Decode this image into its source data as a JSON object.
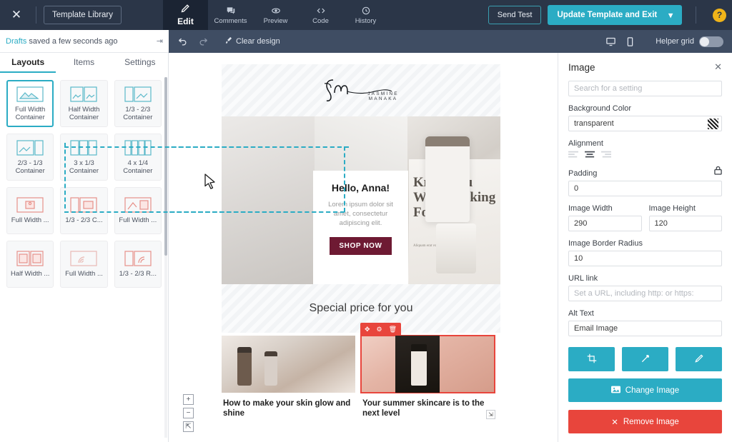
{
  "topbar": {
    "close_icon": "close-icon",
    "template_library_label": "Template Library",
    "nav": [
      {
        "label": "Edit",
        "icon": "pencil-icon",
        "active": true
      },
      {
        "label": "Comments",
        "icon": "comment-icon",
        "active": false
      },
      {
        "label": "Preview",
        "icon": "eye-icon",
        "active": false
      },
      {
        "label": "Code",
        "icon": "code-icon",
        "active": false
      },
      {
        "label": "History",
        "icon": "history-icon",
        "active": false
      }
    ],
    "send_test_label": "Send Test",
    "update_label": "Update Template and Exit",
    "update_chevron": "▾",
    "help_label": "?"
  },
  "secondbar": {
    "drafts_label": "Drafts",
    "saved_text": "saved a few seconds ago",
    "collapse_icon": "collapse-panel-icon",
    "undo_icon": "undo-icon",
    "redo_icon": "redo-icon",
    "clear_design_label": "Clear design",
    "desktop_icon": "desktop-view-icon",
    "mobile_icon": "mobile-view-icon",
    "helper_grid_label": "Helper grid",
    "helper_grid_on": false
  },
  "sidebar": {
    "tabs": [
      {
        "label": "Layouts",
        "active": true
      },
      {
        "label": "Items",
        "active": false
      },
      {
        "label": "Settings",
        "active": false
      }
    ],
    "layouts": [
      {
        "label": "Full Width Container",
        "icon": "full-width-container-icon",
        "selected": true,
        "color": "teal"
      },
      {
        "label": "Half Width Container",
        "icon": "half-width-container-icon",
        "selected": false,
        "color": "teal"
      },
      {
        "label": "1/3 - 2/3 Container",
        "icon": "third-two-thirds-container-icon",
        "selected": false,
        "color": "teal"
      },
      {
        "label": "2/3 - 1/3 Container",
        "icon": "two-thirds-third-container-icon",
        "selected": false,
        "color": "teal"
      },
      {
        "label": "3 x 1/3 Container",
        "icon": "three-thirds-container-icon",
        "selected": false,
        "color": "teal"
      },
      {
        "label": "4 x 1/4 Container",
        "icon": "four-quarters-container-icon",
        "selected": false,
        "color": "teal"
      },
      {
        "label": "Full Width ...",
        "icon": "full-width-image-icon",
        "selected": false,
        "color": "red"
      },
      {
        "label": "1/3 - 2/3 C...",
        "icon": "third-two-thirds-image-icon",
        "selected": false,
        "color": "red"
      },
      {
        "label": "Full Width ...",
        "icon": "full-width-text-image-icon",
        "selected": false,
        "color": "red"
      },
      {
        "label": "Half Width ...",
        "icon": "half-width-image-icon",
        "selected": false,
        "color": "red"
      },
      {
        "label": "Full Width ...",
        "icon": "full-width-banner-icon",
        "selected": false,
        "color": "red"
      },
      {
        "label": "1/3 - 2/3 R...",
        "icon": "third-two-thirds-right-icon",
        "selected": false,
        "color": "red"
      }
    ]
  },
  "canvas": {
    "logo": {
      "monogram": "Jm",
      "name": "JASMINE MANAKA"
    },
    "hero": {
      "heading": "Hello, Anna!",
      "body": "Lorem ipsum dolor sit amet, consectetur adipiscing elit.",
      "button_label": "SHOP NOW",
      "news_headline": "Knew You Were Looking For",
      "news_sub": "Aliquam erat volutpat mauris finibus"
    },
    "special_heading": "Special price for you",
    "cards": [
      {
        "title": "How to make your skin glow and shine",
        "selected": false
      },
      {
        "title": "Your summer skincare is to the next level",
        "selected": true
      }
    ],
    "block_toolbar": {
      "move_icon": "move-icon",
      "settings_icon": "gear-icon",
      "delete_icon": "trash-icon",
      "resize_icon": "resize-handle-icon"
    },
    "zoom_controls": {
      "zoom_in": "+",
      "zoom_out": "−",
      "fit_icon": "fit-to-screen-icon"
    },
    "cursor_icon": "mouse-cursor-icon"
  },
  "rpanel": {
    "title": "Image",
    "close_icon": "close-icon",
    "search_placeholder": "Search for a setting",
    "background_color_label": "Background Color",
    "background_color_value": "transparent",
    "swatch_icon": "transparent-swatch-icon",
    "alignment_label": "Alignment",
    "alignment_options": [
      "align-left-icon",
      "align-center-icon",
      "align-right-icon"
    ],
    "alignment_selected": "align-center-icon",
    "padding_label": "Padding",
    "padding_lock_icon": "lock-icon",
    "padding_value": "0",
    "image_width_label": "Image Width",
    "image_width_value": "290",
    "image_height_label": "Image Height",
    "image_height_value": "120",
    "border_radius_label": "Image Border Radius",
    "border_radius_value": "10",
    "url_link_label": "URL link",
    "url_link_placeholder": "Set a URL, including http: or https:",
    "alt_text_label": "Alt Text",
    "alt_text_value": "Email Image",
    "crop_icon": "crop-icon",
    "wand_icon": "magic-wand-icon",
    "edit_icon": "edit-pen-icon",
    "change_image_label": "Change Image",
    "change_image_icon": "image-icon",
    "remove_image_label": "Remove Image",
    "remove_image_icon": "close-icon"
  },
  "colors": {
    "topbar_bg": "#2b3648",
    "accent_teal": "#2bacc4",
    "danger_red": "#e8453c",
    "help_yellow": "#f0b419",
    "shop_button": "#6e1a33"
  }
}
